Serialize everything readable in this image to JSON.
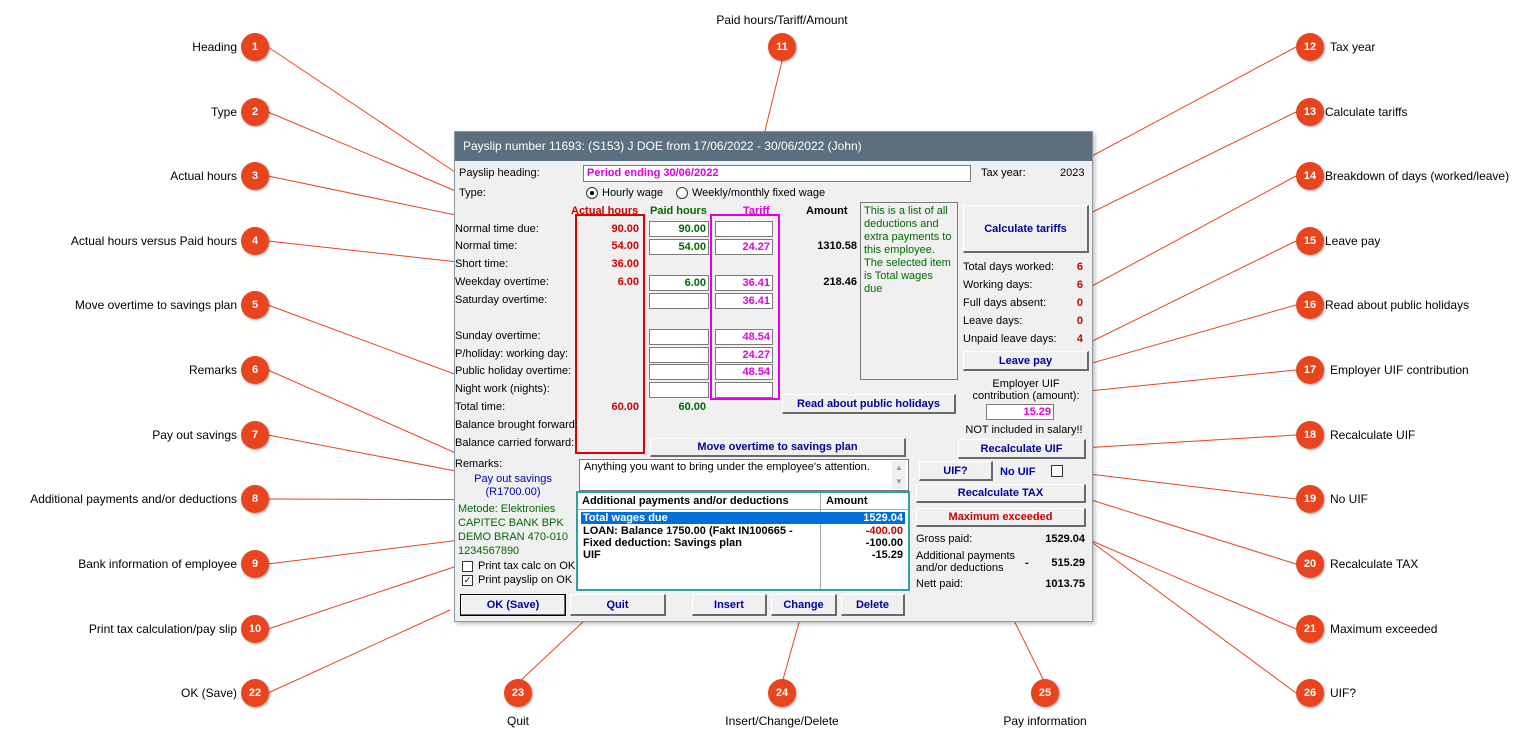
{
  "window": {
    "title": "Payslip number 11693: (S153) J DOE from 17/06/2022 - 30/06/2022 (John)",
    "heading_label": "Payslip heading:",
    "heading_value": "Period ending 30/06/2022",
    "tax_year_label": "Tax year:",
    "tax_year_value": "2023",
    "type_label": "Type:",
    "type_hourly": "Hourly wage",
    "type_fixed": "Weekly/monthly fixed wage",
    "col_actual": "Actual hours",
    "col_paid": "Paid hours",
    "col_tariff": "Tariff",
    "col_amount": "Amount",
    "rows": [
      {
        "label": "Normal time due:",
        "actual": "90.00",
        "paid": "90.00",
        "tariff": "",
        "amount": ""
      },
      {
        "label": "Normal time:",
        "actual": "54.00",
        "paid": "54.00",
        "tariff": "24.27",
        "amount": "1310.58"
      },
      {
        "label": "Short time:",
        "actual": "36.00",
        "paid": "",
        "tariff": "",
        "amount": ""
      },
      {
        "label": "Weekday overtime:",
        "actual": "6.00",
        "paid": "6.00",
        "tariff": "36.41",
        "amount": "218.46"
      },
      {
        "label": "Saturday overtime:",
        "actual": "",
        "paid": "",
        "tariff": "36.41",
        "amount": ""
      },
      {
        "label": "Sunday overtime:",
        "actual": "",
        "paid": "",
        "tariff": "48.54",
        "amount": ""
      },
      {
        "label": "P/holiday: working day:",
        "actual": "",
        "paid": "",
        "tariff": "24.27",
        "amount": ""
      },
      {
        "label": "Public holiday overtime:",
        "actual": "",
        "paid": "",
        "tariff": "48.54",
        "amount": ""
      },
      {
        "label": "Night work (nights):",
        "actual": "",
        "paid": "",
        "tariff": "",
        "amount": ""
      },
      {
        "label": "Total time:",
        "actual": "60.00",
        "paid": "60.00",
        "tariff": "",
        "amount": ""
      },
      {
        "label": "Balance brought forward:",
        "actual": "",
        "paid": "",
        "tariff": "",
        "amount": ""
      },
      {
        "label": "Balance carried forward:",
        "actual": "",
        "paid": "",
        "tariff": "",
        "amount": ""
      }
    ],
    "info_text": "This is a list of all deductions and extra payments to this employee. The selected item is Total wages due",
    "calc_tariffs": "Calculate tariffs",
    "days": [
      {
        "label": "Total days worked:",
        "value": "6"
      },
      {
        "label": "Working days:",
        "value": "6"
      },
      {
        "label": "Full days absent:",
        "value": "0"
      },
      {
        "label": "Leave days:",
        "value": "0"
      },
      {
        "label": "Unpaid leave days:",
        "value": "4"
      }
    ],
    "leave_pay": "Leave pay",
    "read_holidays": "Read about public holidays",
    "employer_uif_label": "Employer UIF contribution (amount):",
    "employer_uif_value": "15.29",
    "not_included": "NOT included in salary!!",
    "move_overtime": "Move overtime to savings plan",
    "recalc_uif": "Recalculate UIF",
    "remarks_label": "Remarks:",
    "remarks_value": "Anything you want to bring under the employee's attention.",
    "pay_out_savings": "Pay out savings",
    "pay_out_amount": "(R1700.00)",
    "uif_q": "UIF?",
    "no_uif": "No UIF",
    "recalc_tax": "Recalculate TAX",
    "max_exceeded": "Maximum exceeded",
    "list_header": "Additional payments and/or deductions",
    "list_amount_header": "Amount",
    "list_items": [
      {
        "desc": "Total wages due",
        "amount": "1529.04"
      },
      {
        "desc": "LOAN: Balance 1750.00 (Fakt IN100665 -",
        "amount": "-400.00"
      },
      {
        "desc": "Fixed deduction: Savings plan",
        "amount": "-100.00"
      },
      {
        "desc": "UIF",
        "amount": "-15.29"
      }
    ],
    "bank": [
      "Metode: Elektronies",
      "CAPITEC BANK BPK",
      "DEMO BRAN  470-010",
      "1234567890"
    ],
    "print_tax": "Print tax calc on OK",
    "print_payslip": "Print payslip on OK",
    "gross_label": "Gross paid:",
    "gross_value": "1529.04",
    "addl_label": "Additional payments and/or deductions",
    "addl_sign": "-",
    "addl_value": "515.29",
    "nett_label": "Nett paid:",
    "nett_value": "1013.75",
    "ok_save": "OK (Save)",
    "quit": "Quit",
    "insert": "Insert",
    "change": "Change",
    "delete": "Delete"
  },
  "callouts": [
    {
      "n": "1",
      "label": "Heading"
    },
    {
      "n": "2",
      "label": "Type"
    },
    {
      "n": "3",
      "label": "Actual hours"
    },
    {
      "n": "4",
      "label": "Actual hours versus Paid hours"
    },
    {
      "n": "5",
      "label": "Move overtime to savings plan"
    },
    {
      "n": "6",
      "label": "Remarks"
    },
    {
      "n": "7",
      "label": "Pay out savings"
    },
    {
      "n": "8",
      "label": "Additional payments and/or deductions"
    },
    {
      "n": "9",
      "label": "Bank information of employee"
    },
    {
      "n": "10",
      "label": "Print tax calculation/pay slip"
    },
    {
      "n": "22",
      "label": "OK (Save)"
    },
    {
      "n": "11",
      "label": "Paid hours/Tariff/Amount"
    },
    {
      "n": "12",
      "label": "Tax year"
    },
    {
      "n": "13",
      "label": "Calculate tariffs"
    },
    {
      "n": "14",
      "label": "Breakdown of days (worked/leave)"
    },
    {
      "n": "15",
      "label": "Leave pay"
    },
    {
      "n": "16",
      "label": "Read about public holidays"
    },
    {
      "n": "17",
      "label": "Employer UIF contribution"
    },
    {
      "n": "18",
      "label": "Recalculate UIF"
    },
    {
      "n": "19",
      "label": "No UIF"
    },
    {
      "n": "20",
      "label": "Recalculate TAX"
    },
    {
      "n": "21",
      "label": "Maximum exceeded"
    },
    {
      "n": "26",
      "label": "UIF?"
    },
    {
      "n": "23",
      "label": "Quit"
    },
    {
      "n": "24",
      "label": "Insert/Change/Delete"
    },
    {
      "n": "25",
      "label": "Pay information"
    }
  ],
  "colors": {
    "badge": "#e8451f",
    "leader": "#e8451f",
    "titlebar": "#5c6f7f",
    "actual": "#d00000",
    "paid": "#006a00",
    "tariff": "#e000e0"
  }
}
